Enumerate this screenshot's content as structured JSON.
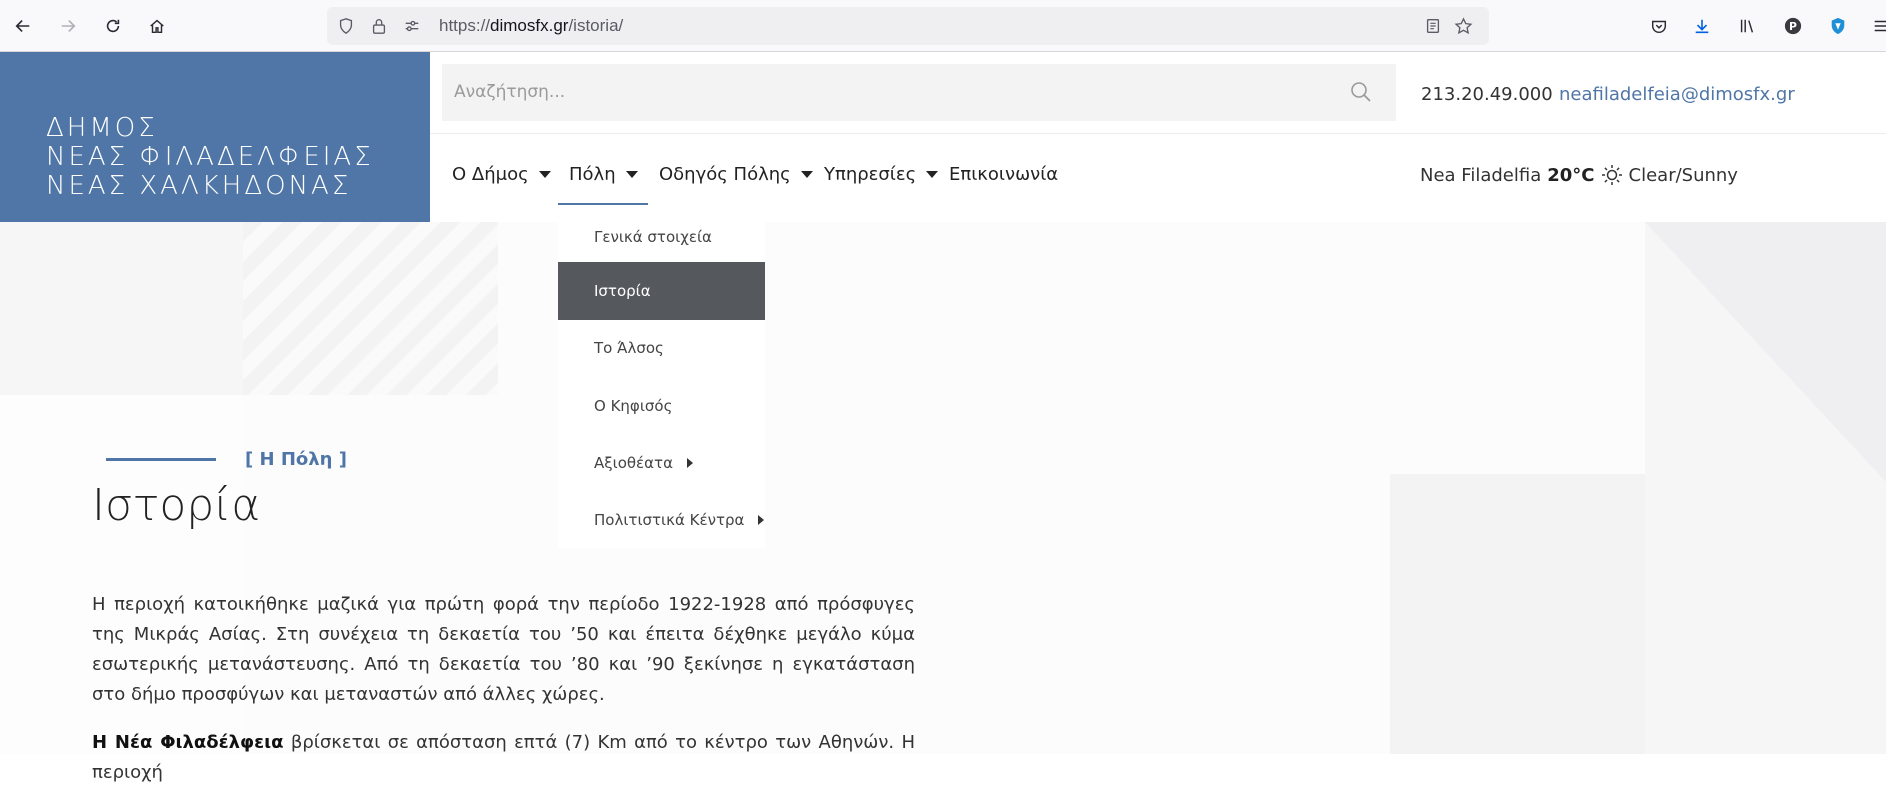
{
  "browser": {
    "url_prefix": "https://",
    "url_domain": "dimosfx.gr",
    "url_path": "/istoria/"
  },
  "logo": {
    "lines": [
      "ΔΗΜΟΣ",
      "ΝΕΑΣ ΦΙΛΑΔΕΛΦΕΙΑΣ",
      "ΝΕΑΣ ΧΑΛΚΗΔΟΝΑΣ"
    ]
  },
  "search": {
    "placeholder": "Αναζήτηση..."
  },
  "contact": {
    "phone": "213.20.49.000",
    "email": "neafiladelfeia@dimosfx.gr"
  },
  "nav": {
    "items": [
      {
        "label": "Ο Δήμος",
        "has_caret": true
      },
      {
        "label": "Πόλη",
        "has_caret": true
      },
      {
        "label": "Οδηγός Πόλης",
        "has_caret": true
      },
      {
        "label": "Υπηρεσίες",
        "has_caret": true
      },
      {
        "label": "Επικοινωνία",
        "has_caret": false
      }
    ]
  },
  "weather": {
    "place": "Nea Filadelfia",
    "temp": "20°C",
    "condition": "Clear/Sunny"
  },
  "dropdown": {
    "items": [
      {
        "label": "Γενικά στοιχεία"
      },
      {
        "label": "Ιστορία",
        "active": true
      },
      {
        "label": "Το Άλσος"
      },
      {
        "label": "Ο Κηφισός"
      },
      {
        "label": "Αξιοθέατα",
        "submenu": true
      },
      {
        "label": "Πολιτιστικά Κέντρα",
        "submenu": true
      }
    ]
  },
  "content": {
    "breadcrumb": "[ Η Πόλη ]",
    "title": "Ιστορία",
    "paragraph1": "Η περιοχή κατοικήθηκε μαζικά για πρώτη φορά την περίοδο 1922-1928 από πρόσφυγες της Μικράς Ασίας. Στη συνέχεια τη δεκαετία του ’50 και έπειτα δέχθηκε μεγάλο κύμα εσωτερικής μετανάστευσης. Από τη δεκαετία του ’80 και ’90 ξεκίνησε η εγκατάσταση στο δήμο προσφύγων και μεταναστών από άλλες χώρες.",
    "paragraph2_bold": "Η  Νέα Φιλαδέλφεια",
    "paragraph2_rest": " βρίσκεται σε απόσταση επτά (7) Km από το κέντρο των Αθηνών. Η περιοχή"
  }
}
